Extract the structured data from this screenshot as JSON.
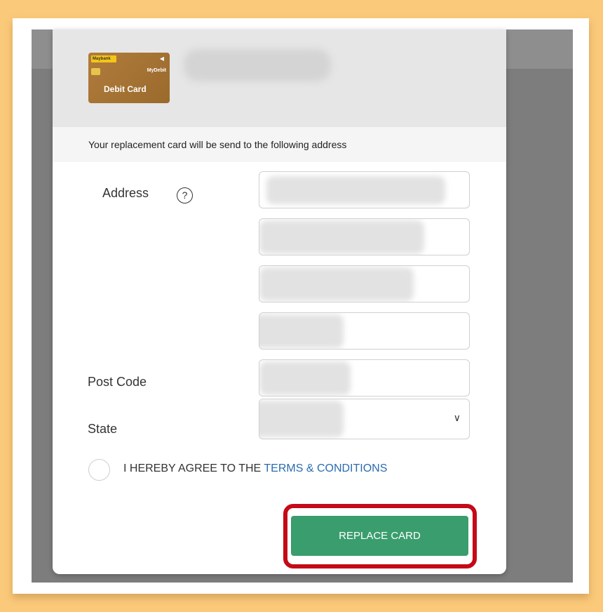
{
  "card": {
    "brand": "Maybank",
    "network": "MyDebit",
    "label": "Debit Card",
    "contactless_icon": "contactless-icon"
  },
  "notice": "Your replacement card will be send to the following address",
  "form": {
    "address_label": "Address",
    "help_icon": "?",
    "postcode_label": "Post Code",
    "state_label": "State",
    "select_arrow": "∨"
  },
  "agreement": {
    "prefix": "I HEREBY AGREE TO THE ",
    "link": "TERMS & CONDITIONS"
  },
  "actions": {
    "replace_label": "REPLACE CARD"
  },
  "colors": {
    "accent": "#3a9d6e",
    "link": "#2b6cb0",
    "highlight": "#c40a18"
  }
}
